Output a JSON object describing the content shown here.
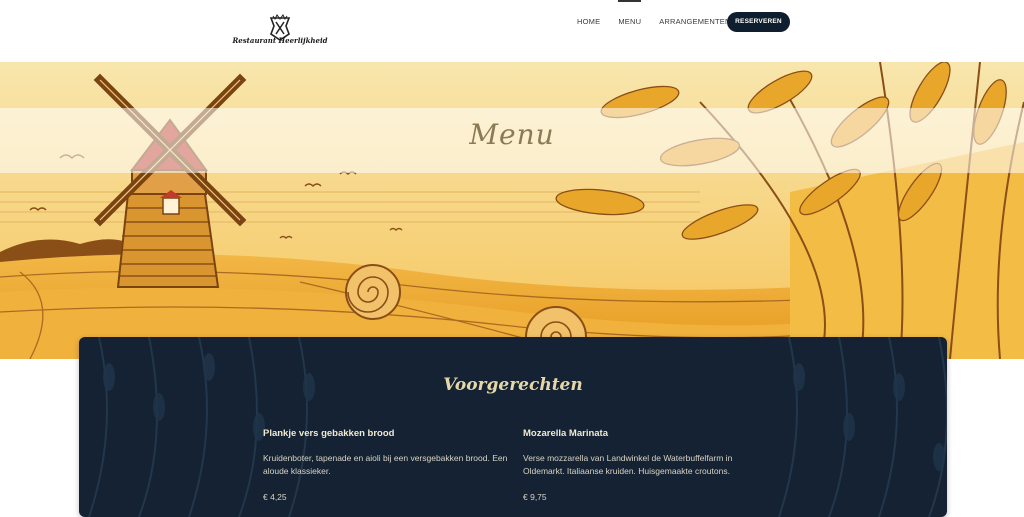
{
  "header": {
    "logo_text": "Restaurant Heerlijkheid",
    "nav": [
      "HOME",
      "MENU",
      "ARRANGEMENTEN"
    ],
    "active_nav": "MENU",
    "reserve_label": "RESERVEREN"
  },
  "hero": {
    "title": "Menu"
  },
  "menu_section": {
    "title": "Voorgerechten",
    "items": [
      {
        "name": "Plankje vers gebakken brood",
        "description": "Kruidenboter, tapenade en aioli bij een versgebakken brood. Een aloude klassieker.",
        "price": "€ 4,25"
      },
      {
        "name": "Mozarella Marinata",
        "description": "Verse mozzarella van Landwinkel de Waterbuffelfarm in Oldemarkt. Italiaanse kruiden. Huisgemaakte croutons.",
        "price": "€ 9,75"
      }
    ]
  },
  "colors": {
    "navy": "#142233",
    "button": "#0f1e2e",
    "gold": "#e6d7a8",
    "wheat": "#e8a72a"
  },
  "icons": [
    "logo-icon"
  ]
}
